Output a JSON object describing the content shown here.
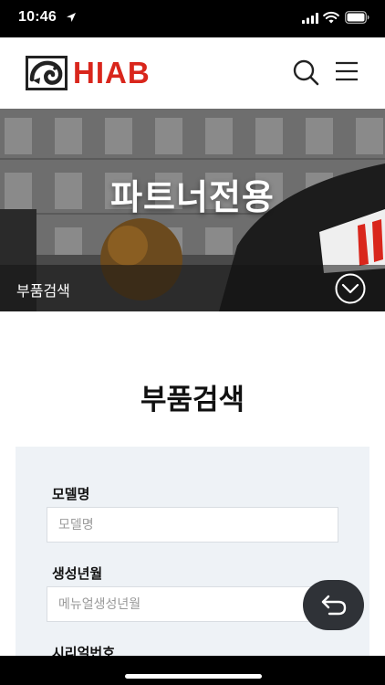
{
  "status_bar": {
    "time": "10:46"
  },
  "header": {
    "logo_text": "HIAB"
  },
  "hero": {
    "title": "파트너전용",
    "section_label": "부품검색"
  },
  "main": {
    "page_title": "부품검색",
    "fields": [
      {
        "label": "모델명",
        "placeholder": "모델명"
      },
      {
        "label": "생성년월",
        "placeholder": "메뉴얼생성년월"
      },
      {
        "label": "시리얼번호"
      }
    ]
  },
  "colors": {
    "brand": "#d9261c",
    "panel": "#eef2f6",
    "fab": "#2f3237"
  },
  "icons": [
    "location-arrow-icon",
    "signal-icon",
    "wifi-icon",
    "battery-icon",
    "search-icon",
    "menu-icon",
    "chevron-down-icon",
    "back-arrow-icon"
  ]
}
